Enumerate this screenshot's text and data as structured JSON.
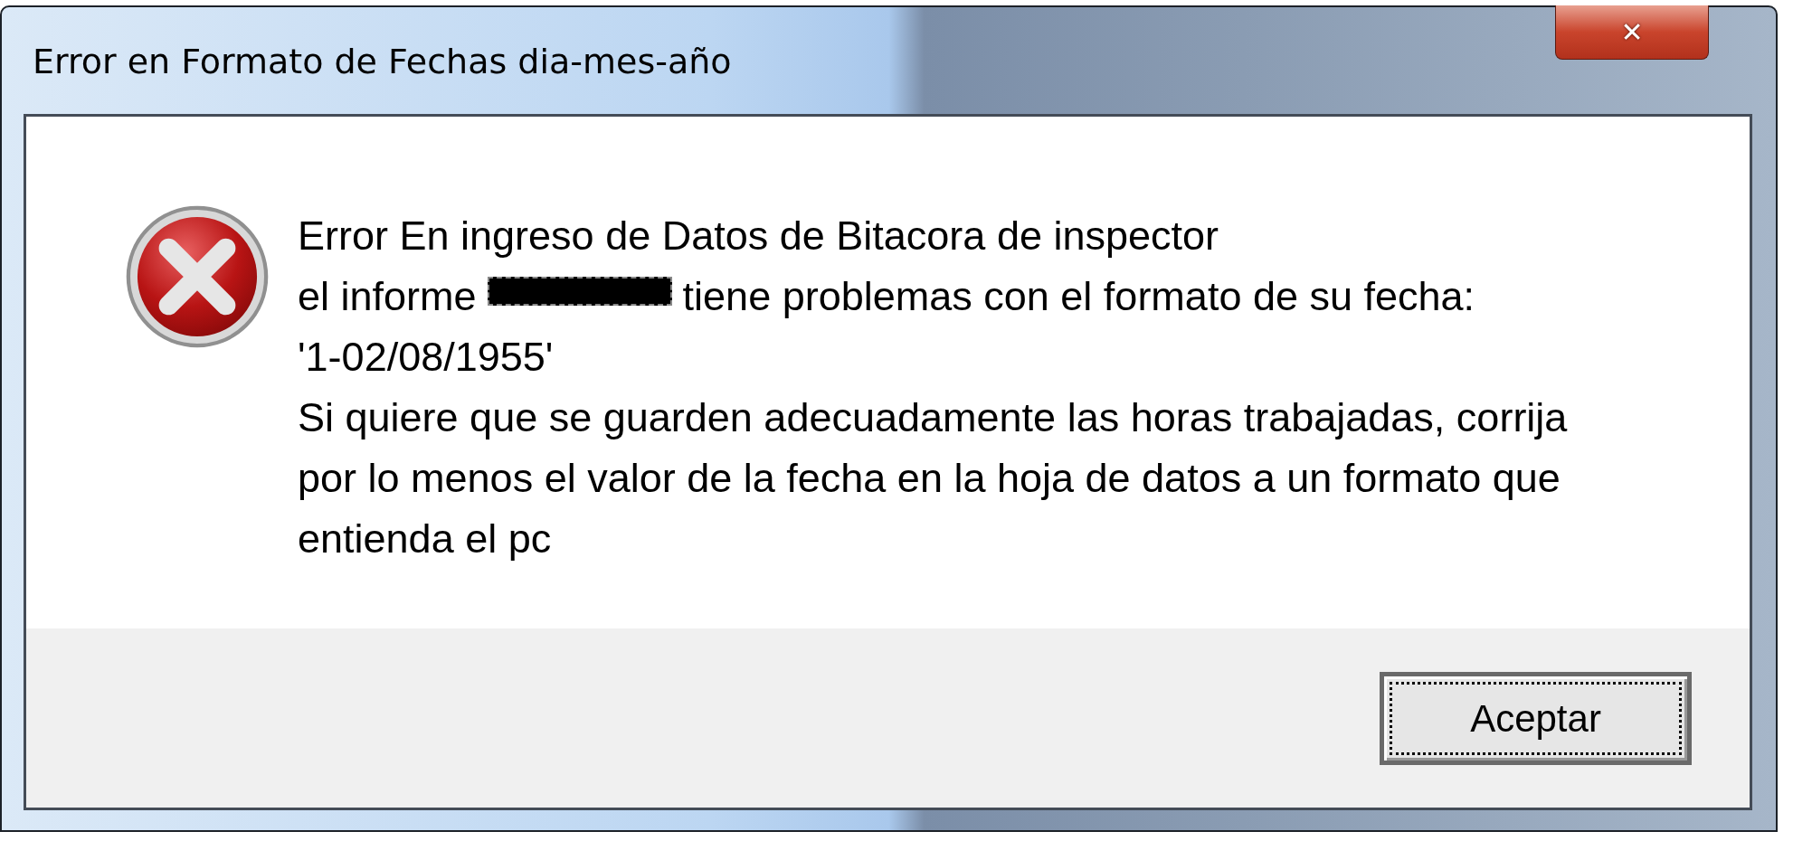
{
  "window": {
    "title": "Error en Formato de Fechas dia-mes-año",
    "close_button": "✕"
  },
  "message": {
    "kind": "error",
    "lines": [
      {
        "segments": [
          {
            "kind": "text",
            "text": "Error En ingreso de Datos de Bitacora de inspector"
          }
        ]
      },
      {
        "segments": [
          {
            "kind": "text",
            "text": "el informe"
          },
          {
            "kind": "redaction"
          },
          {
            "kind": "text",
            "text": "tiene problemas con el formato de su fecha:"
          }
        ]
      },
      {
        "segments": [
          {
            "kind": "text",
            "text": "'1-02/08/1955'"
          }
        ]
      },
      {
        "segments": [
          {
            "kind": "text",
            "text": "Si quiere que se guarden adecuadamente las horas trabajadas, corrija"
          }
        ]
      },
      {
        "segments": [
          {
            "kind": "text",
            "text": "por lo menos el valor de la fecha en la hoja de datos a un formato que"
          }
        ]
      },
      {
        "segments": [
          {
            "kind": "text",
            "text": "entienda el pc"
          }
        ]
      }
    ]
  },
  "buttons": [
    {
      "label": "Aceptar",
      "focused": true
    }
  ]
}
